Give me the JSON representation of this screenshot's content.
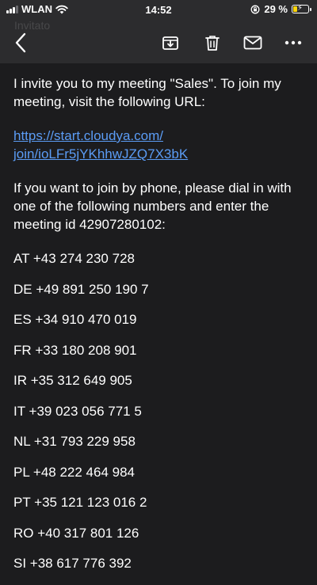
{
  "status_bar": {
    "carrier": "WLAN",
    "time": "14:52",
    "battery_percent": "29 %",
    "battery_level": 0.29,
    "icons": [
      "signal-icon",
      "wifi-icon",
      "orientation-lock-icon",
      "battery-icon"
    ]
  },
  "toolbar": {
    "ghost_subject": "Invitato",
    "icons": [
      "back-icon",
      "archive-icon",
      "trash-icon",
      "mail-icon",
      "more-icon"
    ]
  },
  "email": {
    "intro": "I invite you to my meeting \"Sales\". To join my meeting, visit the following URL:",
    "link_line1": "https://start.cloudya.com/",
    "link_line2": "join/ioLFr5jYKhhwJZQ7X3bK",
    "phone_intro": "If you want to join by phone, please dial in with one of the following numbers and enter the meeting id 42907280102:",
    "dial_numbers": [
      "AT +43 274 230 728",
      "DE +49 891 250 190 7",
      "ES +34 910 470 019",
      "FR +33 180 208 901",
      "IR +35 312 649 905",
      "IT +39 023 056 771 5",
      "NL +31 793 229 958",
      "PL +48 222 464 984",
      "PT +35 121 123 016 2",
      "RO +40 317 801 126",
      "SI +38 617 776 392"
    ]
  },
  "colors": {
    "background": "#1c1c1e",
    "toolbar": "#2c2c2e",
    "link": "#5b9cf5",
    "battery": "#ffd60a"
  }
}
